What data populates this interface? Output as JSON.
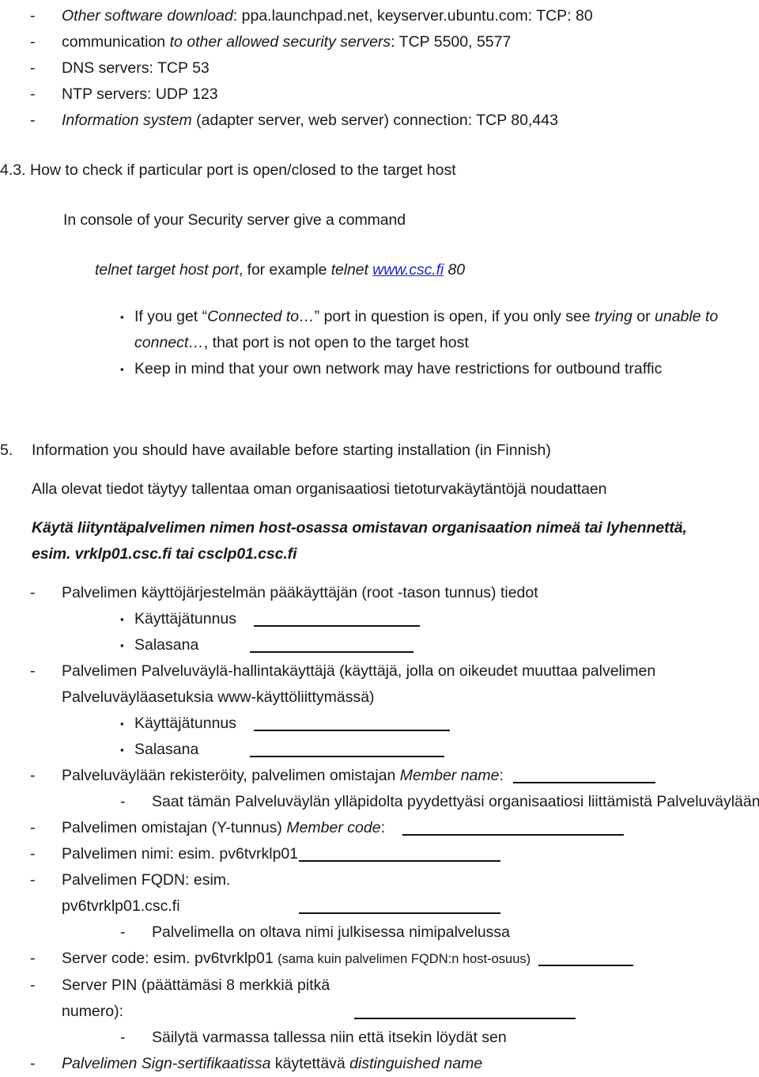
{
  "document": {
    "bullet_dash": "-",
    "bullet_square": "▪"
  },
  "firewall_ports": {
    "items": [
      {
        "italic_lead": "Other software download",
        "rest": ": ppa.launchpad.net, keyserver.ubuntu.com: TCP: 80"
      },
      {
        "plain_lead": "communication ",
        "italic_mid": "to other allowed security servers",
        "rest": ": TCP 5500, 5577"
      },
      {
        "plain_full": "DNS servers: TCP 53"
      },
      {
        "plain_full": "NTP servers: UDP 123"
      },
      {
        "italic_lead": "Information system",
        "rest": " (adapter server,  web server) connection: TCP 80,443"
      }
    ]
  },
  "section_4_3": {
    "number": "4.3.",
    "title": "How to check if particular port is open/closed to the target host",
    "console_line": "In console of your Security server give a command",
    "command_italic": "telnet target host port",
    "command_mid": ", for example ",
    "command_italic_2": "telnet ",
    "command_link": "www.csc.fi",
    "command_tail": " 80",
    "bullets": [
      {
        "pre": "If you get “",
        "italic_1": "Connected to…",
        "mid": "” port in question is open, if you only see ",
        "italic_2": "trying",
        "mid2": "  or ",
        "italic_3": "unable to connect…",
        "tail": ", that port is not open to the target host"
      },
      {
        "plain": "Keep in mind that your own network may have restrictions for outbound traffic"
      }
    ]
  },
  "section_5": {
    "number": "5.",
    "title": "Information you should  have available before starting installation (in Finnish)",
    "intro": "Alla olevat tiedot täytyy tallentaa oman organisaatiosi tietoturvakäytäntöjä noudattaen",
    "emphasis_line_1": "Käytä liityntapalvelimen nimen host-osassa  omistavan organisaation nimeä tai lyhennettä,",
    "emphasis_line_1_fix": "Käytä liityntäpalvelimen nimen host-osassa  omistavan organisaation nimeä tai lyhennettä,",
    "emphasis_line_2": "esim. vrklp01.csc.fi tai csclp01.csc.fi",
    "items": [
      {
        "level": "dash",
        "text": "Palvelimen käyttöjärjestelmän pääkäyttäjän (root -tason tunnus) tiedot"
      },
      {
        "level": "square",
        "label": "Käyttäjätunnus",
        "blank": true
      },
      {
        "level": "square",
        "label": "Salasana",
        "blank": true
      },
      {
        "level": "dash",
        "text": "Palvelimen Palveluväylä-hallintakäyttäjä (käyttäjä, jolla on oikeudet muuttaa palvelimen Palveluväyläasetuksia www-käyttöliittymässä)"
      },
      {
        "level": "square",
        "label": "Käyttäjätunnus",
        "blank": true
      },
      {
        "level": "square",
        "label": "Salasana",
        "blank": true
      }
    ],
    "member_name_line": {
      "pre": "Palveluväylään rekisteröity, palvelimen omistajan ",
      "italic": "Member name",
      "post": ":"
    },
    "member_name_sub": "Saat tämän Palveluväylän ylläpidolta pyydettyäsi organisaatiosi liittämistä Palveluväylään",
    "member_code_line": {
      "pre": "Palvelimen omistajan (Y-tunnus) ",
      "italic": "Member code",
      "post": ":"
    },
    "server_name_line": "Palvelimen nimi: esim. pv6tvrklp01",
    "fqdn_line": "Palvelimen FQDN: esim. pv6tvrklp01.csc.fi",
    "fqdn_sub": "Palvelimella on oltava nimi julkisessa nimipalvelussa",
    "server_code_line": {
      "pre": "Server code: esim. pv6tvrklp01 ",
      "small": "(sama kuin palvelimen FQDN:n host-osuus)"
    },
    "server_pin_line": "Server PIN (päättämäsi 8 merkkiä pitkä numero):",
    "server_pin_sub": "Säilytä varmassa tallessa niin että itsekin löydät sen",
    "sign_cert_line": {
      "italic_1": "Palvelimen Sign-sertifikaatissa",
      "mid": " käytettävä ",
      "italic_2": "distinguished name"
    }
  },
  "colors": {
    "text": "#1a1a1a",
    "link": "#2222cc",
    "rule": "#111111",
    "background": "#ffffff"
  }
}
